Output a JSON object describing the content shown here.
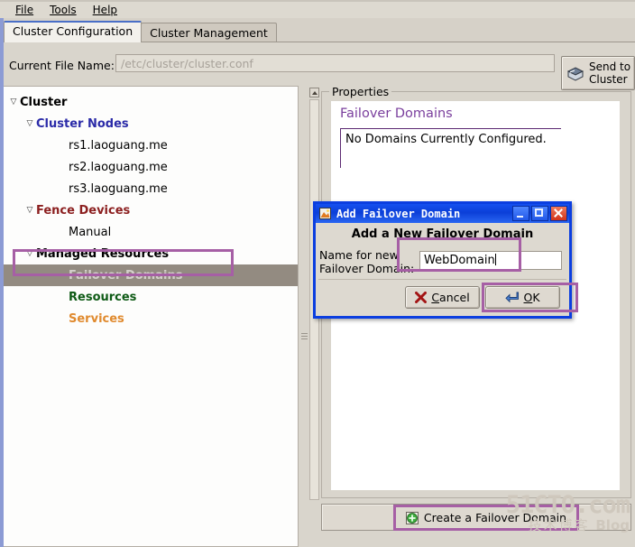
{
  "menubar": {
    "items": [
      {
        "label": "File",
        "mnemonic": "F"
      },
      {
        "label": "Tools",
        "mnemonic": "T"
      },
      {
        "label": "Help",
        "mnemonic": "H"
      }
    ]
  },
  "tabs": [
    {
      "label": "Cluster Configuration",
      "active": true
    },
    {
      "label": "Cluster Management",
      "active": false
    }
  ],
  "toolbar": {
    "file_name_label": "Current File Name:",
    "file_name_value": "/etc/cluster/cluster.conf",
    "send_to_cluster_line1": "Send to",
    "send_to_cluster_line2": "Cluster"
  },
  "tree": {
    "nodes": [
      {
        "label": "Cluster",
        "level": 0,
        "expanded": true,
        "color": "#000000",
        "bold": true,
        "selected": false
      },
      {
        "label": "Cluster Nodes",
        "level": 1,
        "expanded": true,
        "color": "#2b2ba8",
        "bold": true,
        "selected": false
      },
      {
        "label": "rs1.laoguang.me",
        "level": 2,
        "expanded": false,
        "color": "#000000",
        "bold": false,
        "selected": false
      },
      {
        "label": "rs2.laoguang.me",
        "level": 2,
        "expanded": false,
        "color": "#000000",
        "bold": false,
        "selected": false
      },
      {
        "label": "rs3.laoguang.me",
        "level": 2,
        "expanded": false,
        "color": "#000000",
        "bold": false,
        "selected": false
      },
      {
        "label": "Fence Devices",
        "level": 1,
        "expanded": true,
        "color": "#8c2020",
        "bold": true,
        "selected": false
      },
      {
        "label": "Manual",
        "level": 2,
        "expanded": false,
        "color": "#000000",
        "bold": false,
        "selected": false
      },
      {
        "label": "Managed Resources",
        "level": 1,
        "expanded": true,
        "color": "#000000",
        "bold": true,
        "selected": false
      },
      {
        "label": "Failover Domains",
        "level": 2,
        "expanded": false,
        "color": "#d4d0cb",
        "bold": true,
        "selected": true
      },
      {
        "label": "Resources",
        "level": 2,
        "expanded": false,
        "color": "#0f5b16",
        "bold": true,
        "selected": false
      },
      {
        "label": "Services",
        "level": 2,
        "expanded": false,
        "color": "#e08a2e",
        "bold": true,
        "selected": false
      }
    ]
  },
  "properties": {
    "group_legend": "Properties",
    "title": "Failover Domains",
    "body_text": "No Domains Currently Configured."
  },
  "action_bar": {
    "create_button": "Create a Failover Domain"
  },
  "dialog": {
    "title": "Add Failover Domain",
    "heading": "Add a New Failover Domain",
    "field_label_line1": "Name for new",
    "field_label_line2": "Failover Domain:",
    "field_value": "WebDomain",
    "cancel_label": "Cancel",
    "cancel_mnemonic": "C",
    "ok_label": "OK",
    "ok_mnemonic": "O",
    "min_tooltip": "Minimize",
    "max_tooltip": "Maximize",
    "close_tooltip": "Close"
  },
  "watermark": {
    "line1": "51CTO.com",
    "line2_cn": "技术博客",
    "line2_en": "Blog"
  },
  "colors": {
    "accent_purple": "#a65fa5",
    "title_purple": "#7a3f9d",
    "dialog_blue": "#0b3ee0",
    "selection_gray": "#938b81",
    "tab_active_top": "#4a6fc7"
  }
}
